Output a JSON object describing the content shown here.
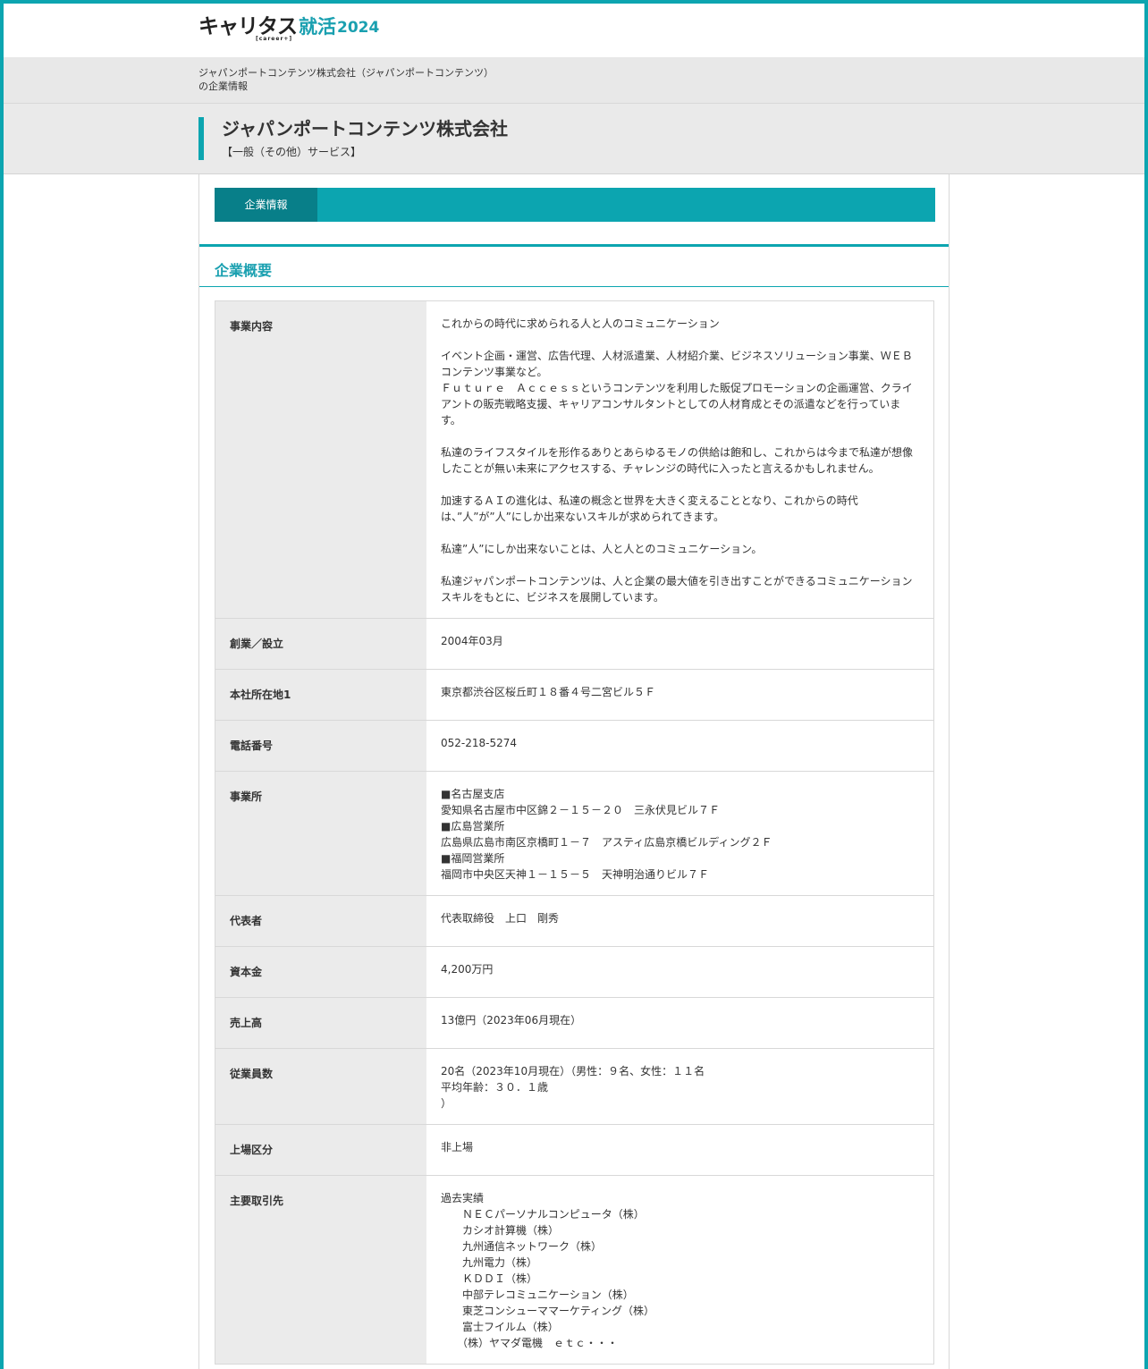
{
  "brand": {
    "logo_main": "キャリタス",
    "logo_sub": "[career+]",
    "logo_shukatsu": "就活",
    "logo_year": "2024",
    "accent_color": "#0ca5b0"
  },
  "breadcrumb": {
    "line1": "ジャパンポートコンテンツ株式会社（ジャパンポートコンテンツ）",
    "line2": "の企業情報"
  },
  "company": {
    "name": "ジャパンポートコンテンツ株式会社",
    "industry": "【一般（その他）サービス】"
  },
  "tabs": [
    {
      "label": "企業情報"
    }
  ],
  "section": {
    "title": "企業概要"
  },
  "rows": [
    {
      "label": "事業内容",
      "value": "これからの時代に求められる人と人のコミュニケーション\n\nイベント企画・運営、広告代理、人材派遣業、人材紹介業、ビジネスソリューション事業、ＷＥＢコンテンツ事業など。\nＦｕｔｕｒｅ　Ａｃｃｅｓｓというコンテンツを利用した販促プロモーションの企画運営、クライアントの販売戦略支援、キャリアコンサルタントとしての人材育成とその派遣などを行っています。\n\n私達のライフスタイルを形作るありとあらゆるモノの供給は飽和し、これからは今まで私達が想像したことが無い未来にアクセスする、チャレンジの時代に入ったと言えるかもしれません。\n\n加速するＡＩの進化は、私達の概念と世界を大きく変えることとなり、これからの時代は、”人”が”人”にしか出来ないスキルが求められてきます。\n\n私達”人”にしか出来ないことは、人と人とのコミュニケーション。\n\n私達ジャパンポートコンテンツは、人と企業の最大値を引き出すことができるコミュニケーションスキルをもとに、ビジネスを展開しています。"
    },
    {
      "label": "創業／設立",
      "value": "2004年03月"
    },
    {
      "label": "本社所在地1",
      "value": "東京都渋谷区桜丘町１８番４号二宮ビル５Ｆ"
    },
    {
      "label": "電話番号",
      "value": "052-218-5274"
    },
    {
      "label": "事業所",
      "value": "■名古屋支店\n愛知県名古屋市中区錦２－１５－２０　三永伏見ビル７Ｆ\n■広島営業所\n広島県広島市南区京橋町１－７　アスティ広島京橋ビルディング２Ｆ\n■福岡営業所\n福岡市中央区天神１－１５－５　天神明治通りビル７Ｆ"
    },
    {
      "label": "代表者",
      "value": "代表取締役　上口　剛秀"
    },
    {
      "label": "資本金",
      "value": "4,200万円"
    },
    {
      "label": "売上高",
      "value": "13億円（2023年06月現在）"
    },
    {
      "label": "従業員数",
      "value": "20名（2023年10月現在）（男性：９名、女性：１１名\n平均年齢：３０．１歳\n）"
    },
    {
      "label": "上場区分",
      "value": "非上場"
    },
    {
      "label": "主要取引先",
      "value": "過去実績\n　　ＮＥＣパーソナルコンピュータ（株）\n　　カシオ計算機（株）\n　　九州通信ネットワーク（株）\n　　九州電力（株）\n　　ＫＤＤＩ（株）\n　　中部テレコミュニケーション（株）\n　　東芝コンシューママーケティング（株）\n　　富士フイルム（株）\n　　（株）ヤマダ電機　ｅｔｃ・・・"
    }
  ]
}
